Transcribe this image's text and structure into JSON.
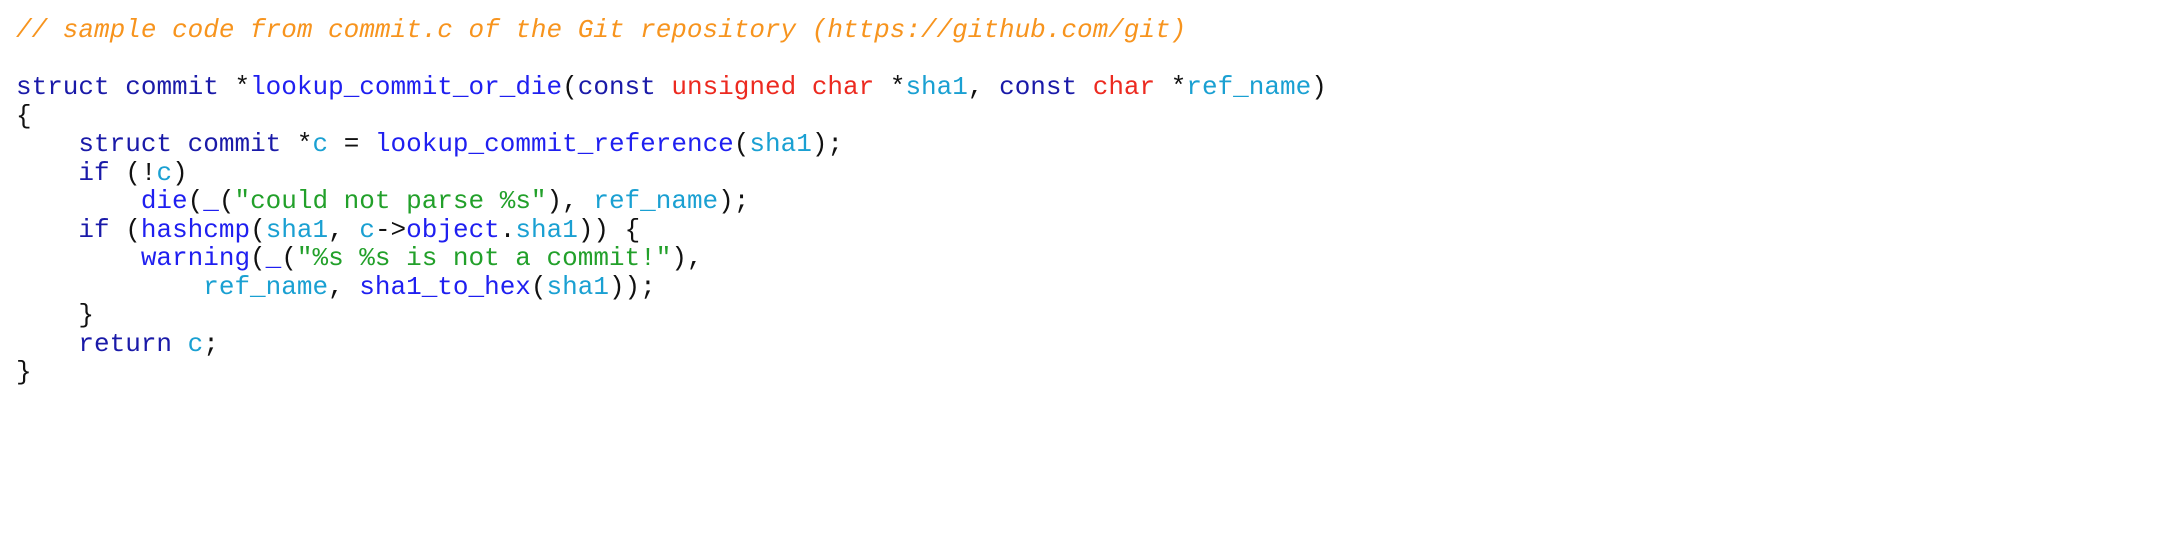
{
  "colors": {
    "kw": "#1a1aa8",
    "fn": "#1f1ff0",
    "var": "#1aa0d2",
    "type": "#ec2a20",
    "str": "#22a02a",
    "cmt": "#f7941e",
    "plain": "#111111"
  },
  "code": {
    "lines": [
      [
        {
          "t": "// sample code from commit.c of the Git repository (https://github.com/git)",
          "c": "cmt"
        }
      ],
      [],
      [
        {
          "t": "struct",
          "c": "kw"
        },
        {
          "t": " ",
          "c": "plain"
        },
        {
          "t": "commit",
          "c": "kw"
        },
        {
          "t": " *",
          "c": "plain"
        },
        {
          "t": "lookup_commit_or_die",
          "c": "fn"
        },
        {
          "t": "(",
          "c": "plain"
        },
        {
          "t": "const",
          "c": "kw"
        },
        {
          "t": " ",
          "c": "plain"
        },
        {
          "t": "unsigned",
          "c": "type"
        },
        {
          "t": " ",
          "c": "plain"
        },
        {
          "t": "char",
          "c": "type"
        },
        {
          "t": " *",
          "c": "plain"
        },
        {
          "t": "sha1",
          "c": "var"
        },
        {
          "t": ", ",
          "c": "plain"
        },
        {
          "t": "const",
          "c": "kw"
        },
        {
          "t": " ",
          "c": "plain"
        },
        {
          "t": "char",
          "c": "type"
        },
        {
          "t": " *",
          "c": "plain"
        },
        {
          "t": "ref_name",
          "c": "var"
        },
        {
          "t": ")",
          "c": "plain"
        }
      ],
      [
        {
          "t": "{",
          "c": "plain"
        }
      ],
      [
        {
          "t": "    ",
          "c": "plain"
        },
        {
          "t": "struct",
          "c": "kw"
        },
        {
          "t": " ",
          "c": "plain"
        },
        {
          "t": "commit",
          "c": "kw"
        },
        {
          "t": " *",
          "c": "plain"
        },
        {
          "t": "c",
          "c": "var"
        },
        {
          "t": " = ",
          "c": "plain"
        },
        {
          "t": "lookup_commit_reference",
          "c": "fn"
        },
        {
          "t": "(",
          "c": "plain"
        },
        {
          "t": "sha1",
          "c": "var"
        },
        {
          "t": ");",
          "c": "plain"
        }
      ],
      [
        {
          "t": "    ",
          "c": "plain"
        },
        {
          "t": "if",
          "c": "kw"
        },
        {
          "t": " (!",
          "c": "plain"
        },
        {
          "t": "c",
          "c": "var"
        },
        {
          "t": ")",
          "c": "plain"
        }
      ],
      [
        {
          "t": "        ",
          "c": "plain"
        },
        {
          "t": "die",
          "c": "fn"
        },
        {
          "t": "(",
          "c": "plain"
        },
        {
          "t": "_",
          "c": "fn"
        },
        {
          "t": "(",
          "c": "plain"
        },
        {
          "t": "\"could not parse %s\"",
          "c": "str"
        },
        {
          "t": "), ",
          "c": "plain"
        },
        {
          "t": "ref_name",
          "c": "var"
        },
        {
          "t": ");",
          "c": "plain"
        }
      ],
      [
        {
          "t": "    ",
          "c": "plain"
        },
        {
          "t": "if",
          "c": "kw"
        },
        {
          "t": " (",
          "c": "plain"
        },
        {
          "t": "hashcmp",
          "c": "fn"
        },
        {
          "t": "(",
          "c": "plain"
        },
        {
          "t": "sha1",
          "c": "var"
        },
        {
          "t": ", ",
          "c": "plain"
        },
        {
          "t": "c",
          "c": "var"
        },
        {
          "t": "->",
          "c": "plain"
        },
        {
          "t": "object",
          "c": "fn"
        },
        {
          "t": ".",
          "c": "plain"
        },
        {
          "t": "sha1",
          "c": "var"
        },
        {
          "t": ")) {",
          "c": "plain"
        }
      ],
      [
        {
          "t": "        ",
          "c": "plain"
        },
        {
          "t": "warning",
          "c": "fn"
        },
        {
          "t": "(",
          "c": "plain"
        },
        {
          "t": "_",
          "c": "fn"
        },
        {
          "t": "(",
          "c": "plain"
        },
        {
          "t": "\"%s %s is not a commit!\"",
          "c": "str"
        },
        {
          "t": "),",
          "c": "plain"
        }
      ],
      [
        {
          "t": "            ",
          "c": "plain"
        },
        {
          "t": "ref_name",
          "c": "var"
        },
        {
          "t": ", ",
          "c": "plain"
        },
        {
          "t": "sha1_to_hex",
          "c": "fn"
        },
        {
          "t": "(",
          "c": "plain"
        },
        {
          "t": "sha1",
          "c": "var"
        },
        {
          "t": "));",
          "c": "plain"
        }
      ],
      [
        {
          "t": "    }",
          "c": "plain"
        }
      ],
      [
        {
          "t": "    ",
          "c": "plain"
        },
        {
          "t": "return",
          "c": "kw"
        },
        {
          "t": " ",
          "c": "plain"
        },
        {
          "t": "c",
          "c": "var"
        },
        {
          "t": ";",
          "c": "plain"
        }
      ],
      [
        {
          "t": "}",
          "c": "plain"
        }
      ]
    ]
  }
}
